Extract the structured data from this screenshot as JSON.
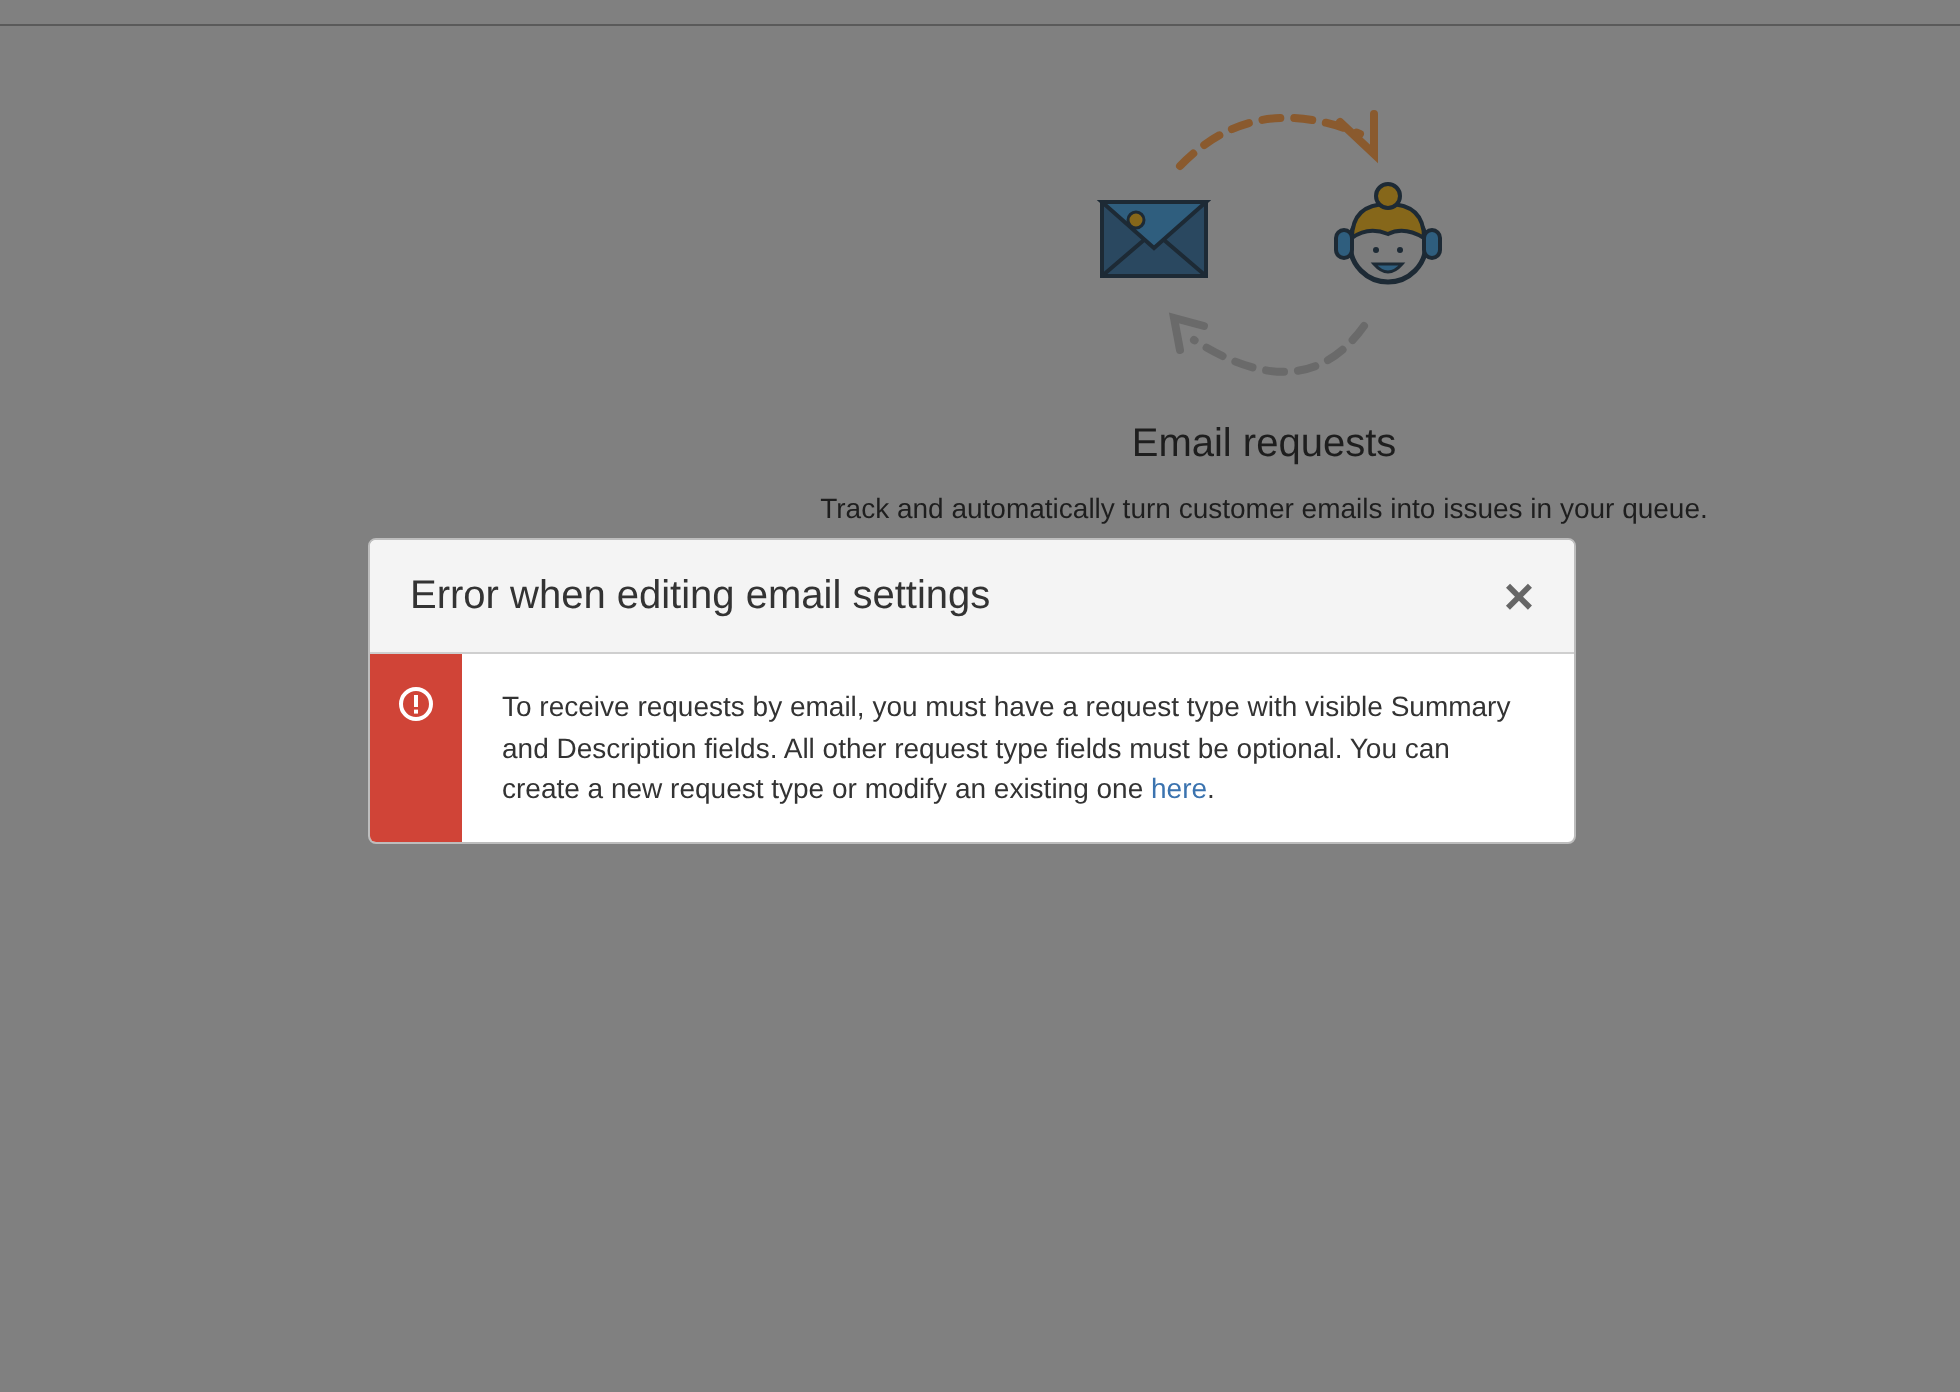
{
  "page": {
    "title": "Email requests",
    "description": "Track and automatically turn customer emails into issues in your queue."
  },
  "dialog": {
    "title": "Error when editing email settings",
    "close": "×",
    "message": "To receive requests by email, you must have a request type with visible Summary and Description fields. All other request type fields must be optional. You can create a new request type or modify an existing one ",
    "link": "here",
    "after_link": "."
  }
}
